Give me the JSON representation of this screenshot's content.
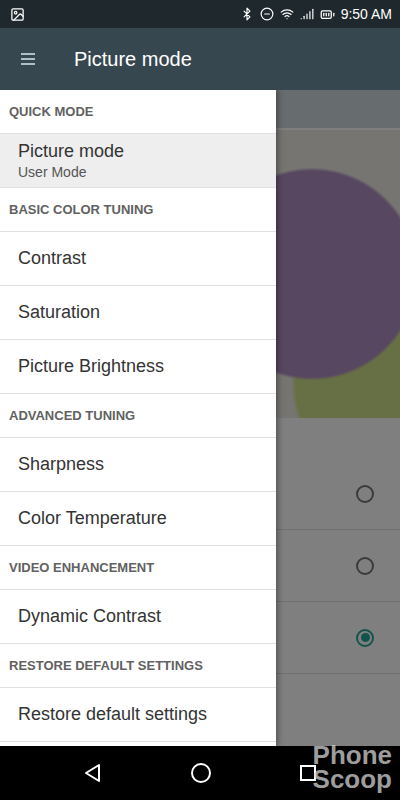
{
  "status_bar": {
    "time": "9:50 AM"
  },
  "toolbar": {
    "title": "Picture mode"
  },
  "drawer": {
    "sections": [
      {
        "header": "QUICK MODE",
        "items": [
          {
            "label": "Picture mode",
            "sublabel": "User Mode",
            "selected": true
          }
        ]
      },
      {
        "header": "BASIC COLOR TUNING",
        "items": [
          {
            "label": "Contrast",
            "selected": false
          },
          {
            "label": "Saturation",
            "selected": false
          },
          {
            "label": "Picture Brightness",
            "selected": false
          }
        ]
      },
      {
        "header": "ADVANCED TUNING",
        "items": [
          {
            "label": "Sharpness",
            "selected": false
          },
          {
            "label": "Color Temperature",
            "selected": false
          }
        ]
      },
      {
        "header": "VIDEO ENHANCEMENT",
        "items": [
          {
            "label": "Dynamic Contrast",
            "selected": false
          }
        ]
      },
      {
        "header": "RESTORE DEFAULT SETTINGS",
        "items": [
          {
            "label": "Restore default settings",
            "selected": false
          }
        ]
      }
    ]
  },
  "background": {
    "options": [
      {
        "selected": false
      },
      {
        "selected": false
      },
      {
        "selected": true
      }
    ]
  },
  "watermark": "Phone Scoop"
}
